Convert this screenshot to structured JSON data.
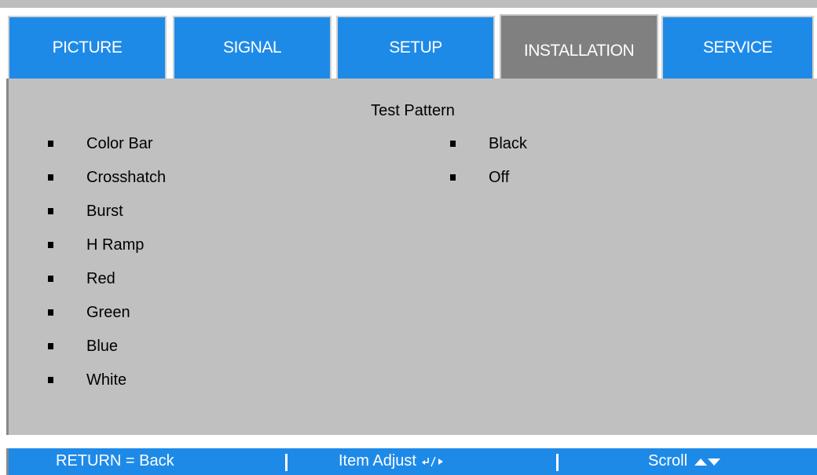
{
  "tabs": [
    {
      "label": "PICTURE",
      "active": false
    },
    {
      "label": "SIGNAL",
      "active": false
    },
    {
      "label": "SETUP",
      "active": false
    },
    {
      "label": "INSTALLATION",
      "active": true
    },
    {
      "label": "SERVICE",
      "active": false
    }
  ],
  "panel": {
    "title": "Test Pattern",
    "left_items": [
      "Color Bar",
      "Crosshatch",
      "Burst",
      "H Ramp",
      "Red",
      "Green",
      "Blue",
      "White"
    ],
    "right_items": [
      "Black",
      "Off"
    ]
  },
  "footer": {
    "return_label": "RETURN = Back",
    "item_adjust_label": "Item Adjust",
    "scroll_label": "Scroll"
  },
  "colors": {
    "tab_blue": "#1e8ae8",
    "tab_active_grey": "#808080",
    "panel_grey": "#c0c0c0"
  },
  "icons": {
    "item_adjust": "enter-right-arrow-icon",
    "scroll": "up-down-triangle-icon"
  }
}
